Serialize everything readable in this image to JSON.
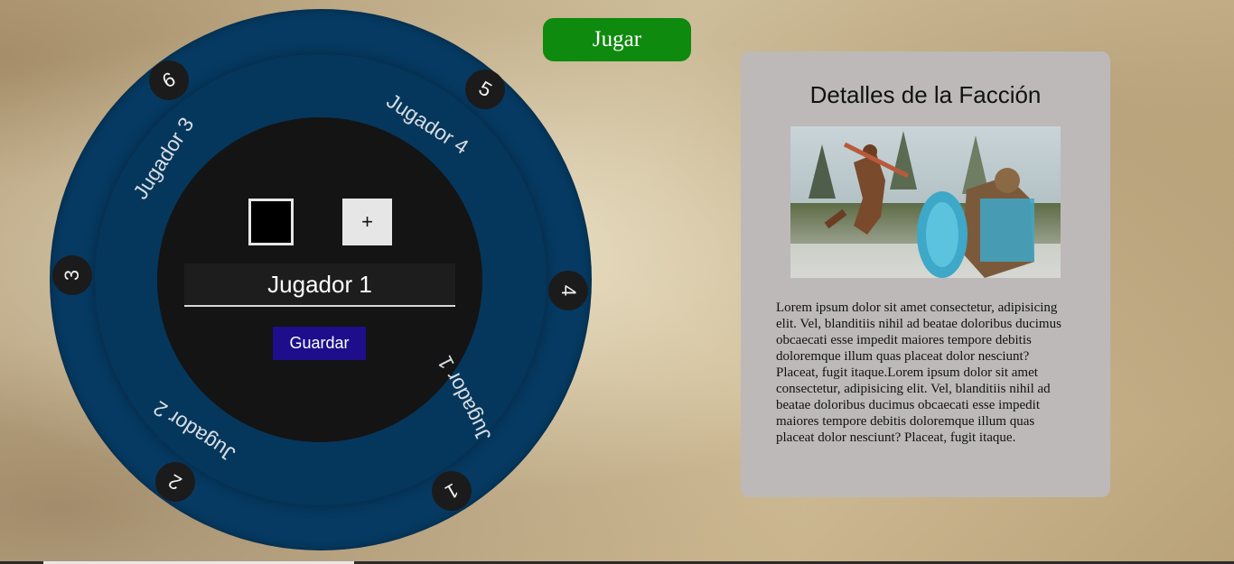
{
  "header": {
    "play_label": "Jugar"
  },
  "wheel": {
    "slots": [
      {
        "number": "1",
        "label": "Jugador 1"
      },
      {
        "number": "2",
        "label": "Jugador 2"
      },
      {
        "number": "3",
        "label": ""
      },
      {
        "number": "4",
        "label": "Jugador 3"
      },
      {
        "number": "5",
        "label": "Jugador 4"
      },
      {
        "number": "6",
        "label": ""
      }
    ],
    "labels": {
      "jugador1": "Jugador 1",
      "jugador2": "Jugador 2",
      "jugador3": "Jugador 3",
      "jugador4": "Jugador 4"
    },
    "numbers": {
      "n1": "1",
      "n2": "2",
      "n3": "3",
      "n4": "4",
      "n5": "5",
      "n6": "6"
    },
    "editor": {
      "selected_color": "#000000",
      "add_label": "+",
      "name_value": "Jugador 1",
      "save_label": "Guardar"
    }
  },
  "details": {
    "title": "Detalles de la Facción",
    "description": "Lorem ipsum dolor sit amet consectetur, adipisicing elit. Vel, blanditiis nihil ad beatae doloribus ducimus obcaecati esse impedit maiores tempore debitis doloremque illum quas placeat dolor nesciunt? Placeat, fugit itaque.Lorem ipsum dolor sit amet consectetur, adipisicing elit. Vel, blanditiis nihil ad beatae doloribus ducimus obcaecati esse impedit maiores tempore debitis doloremque illum quas placeat dolor nesciunt? Placeat, fugit itaque."
  },
  "colors": {
    "play_button": "#0e8a0e",
    "wheel_outer": "#063a62",
    "wheel_inner": "#141414",
    "save_button": "#1e0e8c",
    "panel": "#bdb9b9"
  }
}
